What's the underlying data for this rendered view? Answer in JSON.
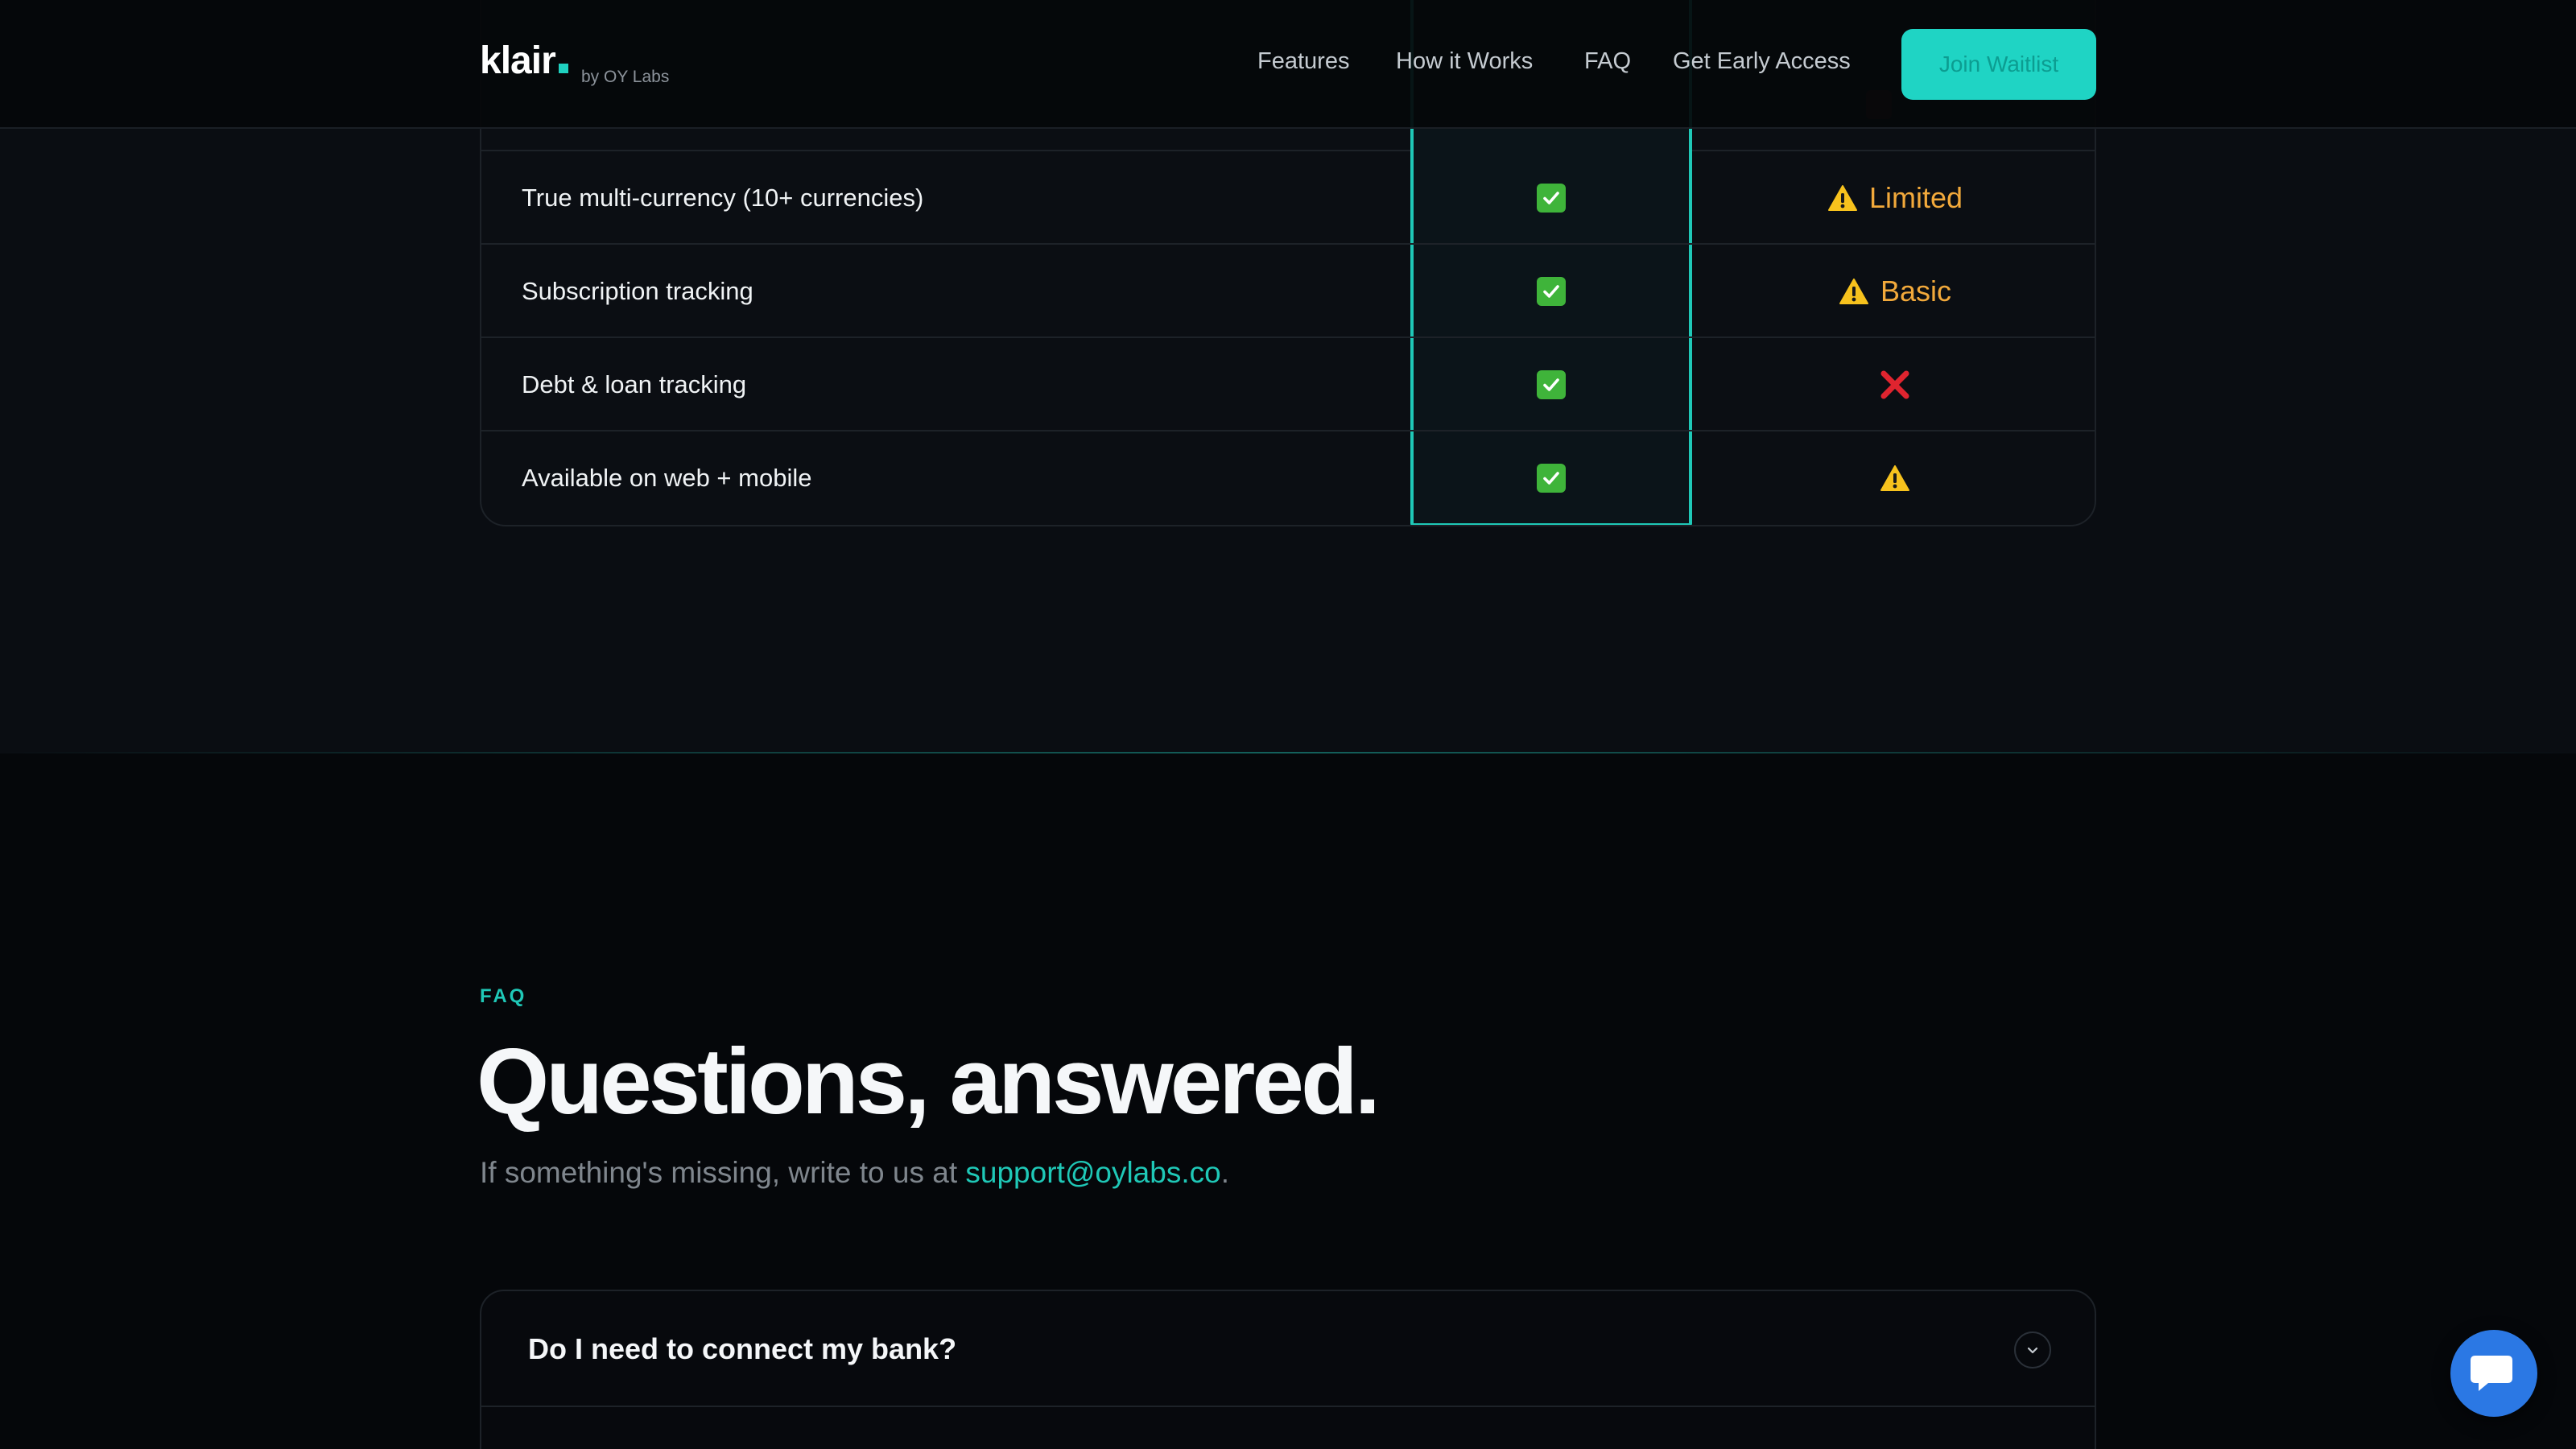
{
  "header": {
    "logo": "klair",
    "logo_by": "by OY Labs",
    "nav": [
      "Features",
      "How it Works",
      "FAQ",
      "Get Early Access"
    ],
    "cta_label": "Join Waitlist"
  },
  "comparison": {
    "rows": [
      {
        "feature": "True multi-currency (10+ currencies)",
        "klair": "check-icon",
        "other_icon": "warning-icon",
        "other_label": "Limited"
      },
      {
        "feature": "Subscription tracking",
        "klair": "check-icon",
        "other_icon": "warning-icon",
        "other_label": "Basic"
      },
      {
        "feature": "Debt & loan tracking",
        "klair": "check-icon",
        "other_icon": "x-icon",
        "other_label": ""
      },
      {
        "feature": "Available on web + mobile",
        "klair": "check-icon",
        "other_icon": "warning-icon",
        "other_label": ""
      }
    ]
  },
  "faq": {
    "eyebrow": "FAQ",
    "title": "Questions, answered.",
    "subtitle_prefix": "If something's missing, write to us at ",
    "email": "support@oylabs.co",
    "subtitle_suffix": ".",
    "items": [
      {
        "question": "Do I need to connect my bank?"
      }
    ]
  },
  "chat": {
    "icon": "chat-icon"
  },
  "colors": {
    "accent": "#1fd4c4",
    "background": "#05070a",
    "check": "#3fb43a",
    "warning": "#f2a93b",
    "x": "#e0242f",
    "chat": "#2b78e4"
  }
}
